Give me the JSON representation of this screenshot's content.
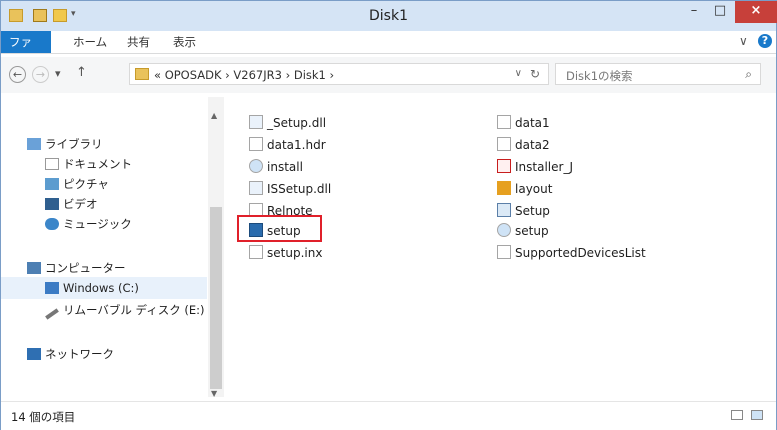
{
  "window": {
    "title": "Disk1",
    "minimize": "–",
    "maximize": "□",
    "close": "×"
  },
  "ribbon": {
    "tabs": [
      "ファイル",
      "ホーム",
      "共有",
      "表示"
    ],
    "expand": "∨",
    "help": "?"
  },
  "nav": {
    "back": "←",
    "forward": "→",
    "recent": "▾",
    "up": "↑"
  },
  "address": {
    "path": "« OPOSADK  ›  V267JR3  ›  Disk1  ›",
    "dropdown": "∨",
    "refresh": "↻"
  },
  "search": {
    "placeholder": "Disk1の検索",
    "icon": "⌕"
  },
  "navpane": {
    "items": [
      {
        "label": "ライブラリ",
        "icon": "library-icon"
      },
      {
        "label": "ドキュメント",
        "icon": "documents-icon"
      },
      {
        "label": "ピクチャ",
        "icon": "pictures-icon"
      },
      {
        "label": "ビデオ",
        "icon": "videos-icon"
      },
      {
        "label": "ミュージック",
        "icon": "music-icon"
      },
      {
        "label": "コンピューター",
        "icon": "computer-icon"
      },
      {
        "label": "Windows (C:)",
        "icon": "drive-icon"
      },
      {
        "label": "リムーバブル ディスク (E:)",
        "icon": "removable-disk-icon"
      },
      {
        "label": "ネットワーク",
        "icon": "network-icon"
      }
    ]
  },
  "files": {
    "col1": [
      "_Setup.dll",
      "data1.hdr",
      "install",
      "ISSetup.dll",
      "Relnote",
      "setup",
      "setup.inx"
    ],
    "col2": [
      "data1",
      "data2",
      "Installer_J",
      "layout",
      "Setup",
      "setup",
      "SupportedDevicesList"
    ]
  },
  "status": {
    "count": "14 個の項目"
  },
  "colors": {
    "accent": "#1979ca",
    "highlight": "#e0202a",
    "close": "#c7403a"
  }
}
